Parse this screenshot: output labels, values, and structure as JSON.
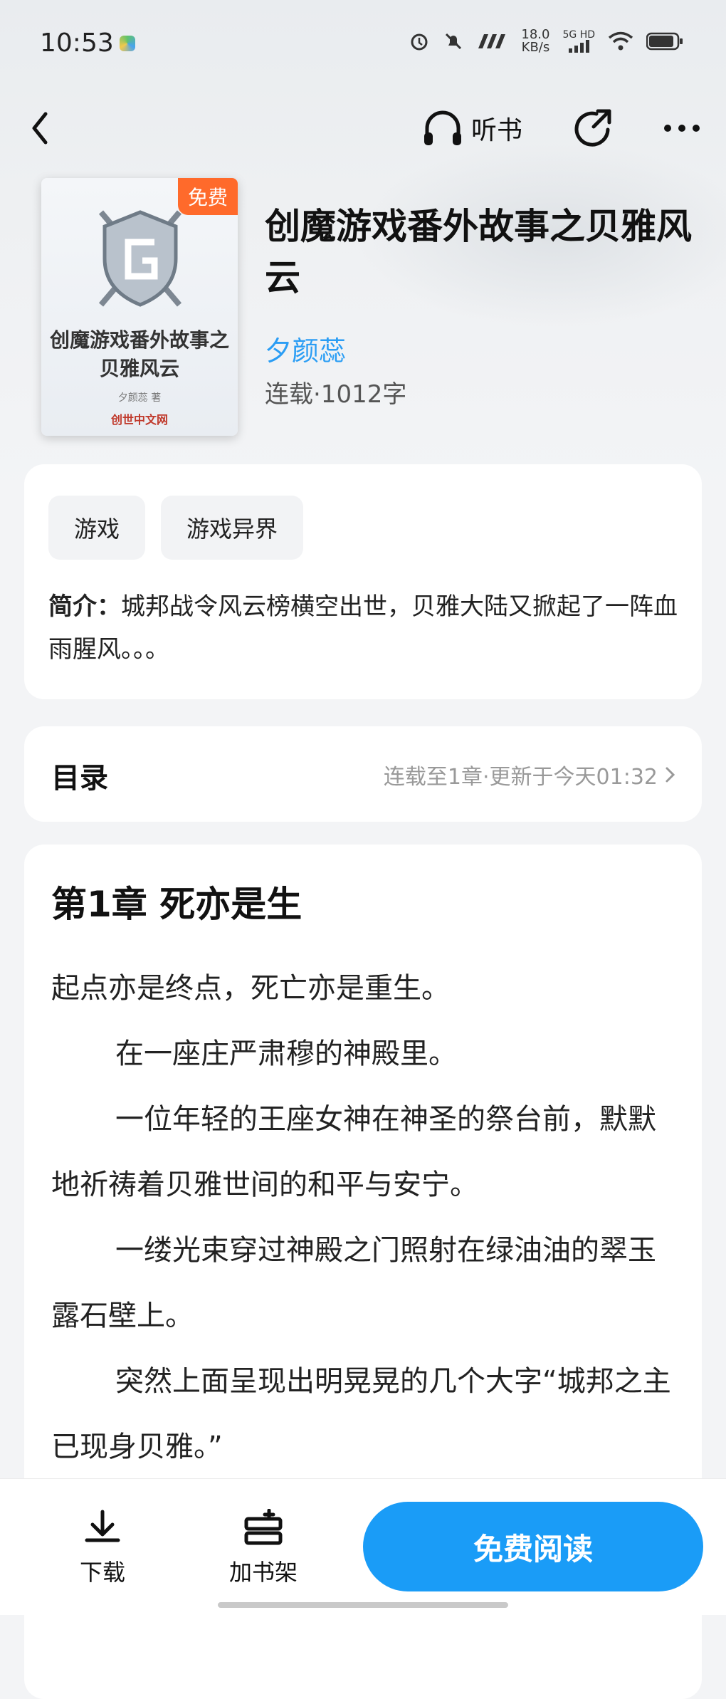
{
  "status_bar": {
    "time": "10:53",
    "net_speed": "18.0",
    "net_unit": "KB/s",
    "network": "5G HD"
  },
  "nav": {
    "listen_label": "听书"
  },
  "book": {
    "cover_badge": "免费",
    "cover_title": "创魔游戏番外故事之贝雅风云",
    "cover_author": "夕颜蕊 著",
    "cover_publisher": "创世中文网",
    "title": "创魔游戏番外故事之贝雅风云",
    "author": "夕颜蕊",
    "meta": "连载·1012字"
  },
  "intro_card": {
    "tags": [
      "游戏",
      "游戏异界"
    ],
    "intro_label": "简介：",
    "intro_text": "城邦战令风云榜横空出世，贝雅大陆又掀起了一阵血雨腥风。。。"
  },
  "toc": {
    "title": "目录",
    "status": "连载至1章·更新于今天01:32"
  },
  "chapter": {
    "title": "第1章 死亦是生",
    "paragraphs": [
      "起点亦是终点，死亡亦是重生。",
      "在一座庄严肃穆的神殿里。",
      "一位年轻的王座女神在神圣的祭台前，默默地祈祷着贝雅世间的和平与安宁。",
      "一缕光束穿过神殿之门照射在绿油油的翠玉露石壁上。",
      "突然上面呈现出明晃晃的几个大字“城邦之主已现身贝雅。”"
    ]
  },
  "bottom_bar": {
    "download_label": "下载",
    "shelf_label": "加书架",
    "read_label": "免费阅读"
  },
  "colors": {
    "accent": "#1a9cf7",
    "badge": "#ff6a2b",
    "author_link": "#2a9df4"
  }
}
